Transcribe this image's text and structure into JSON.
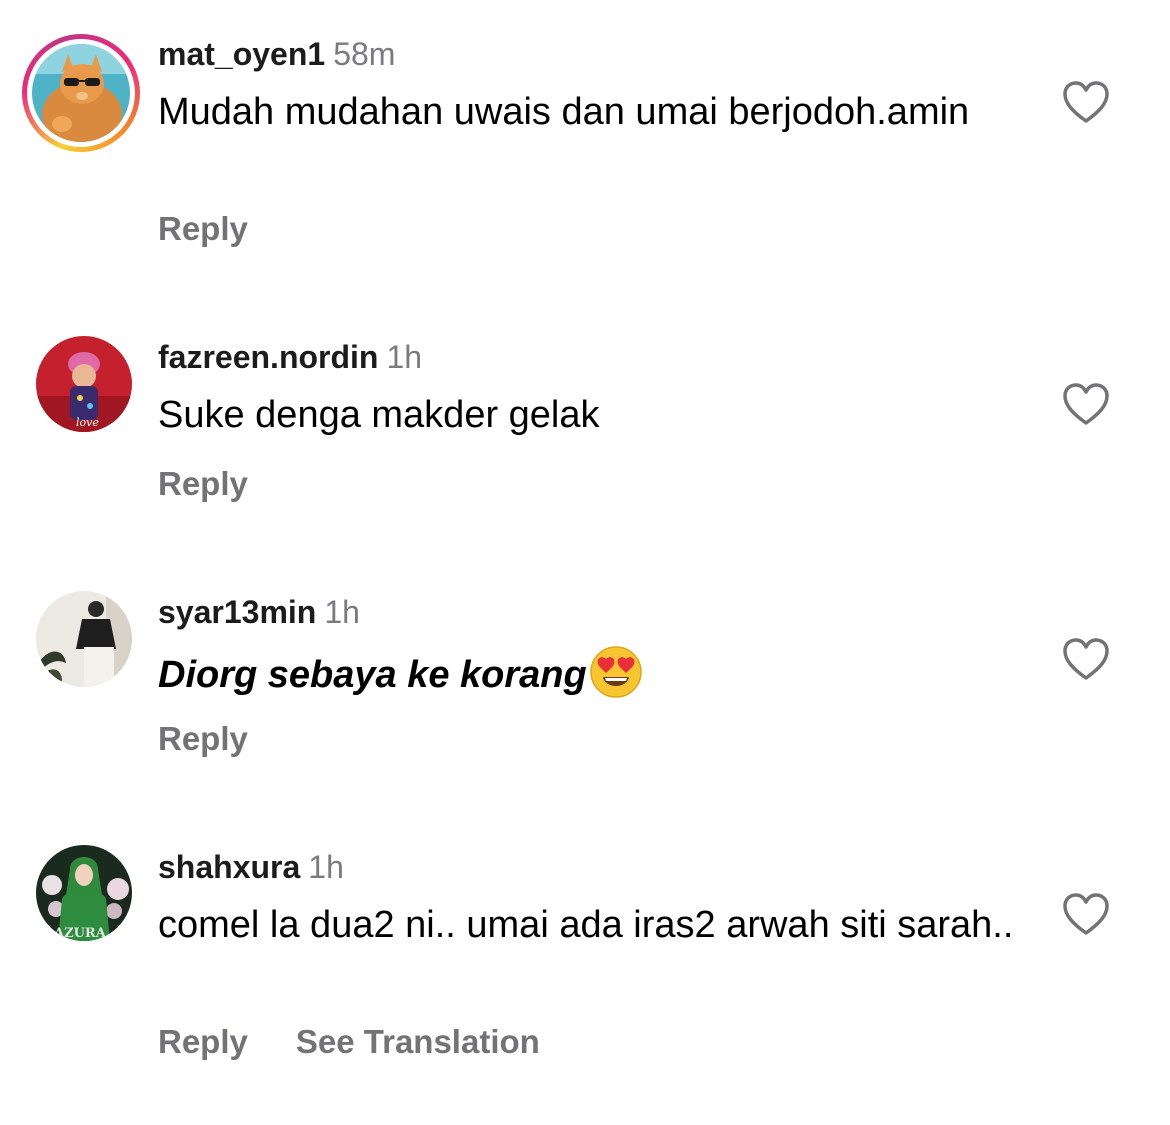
{
  "comments": [
    {
      "username": "mat_oyen1",
      "time": "58m",
      "text": "Mudah mudahan uwais dan umai berjodoh.amin",
      "reply_label": "Reply",
      "has_story_ring": true,
      "liked": false
    },
    {
      "username": "fazreen.nordin",
      "time": "1h",
      "text": "Suke denga makder gelak",
      "reply_label": "Reply",
      "has_story_ring": false,
      "liked": false
    },
    {
      "username": "syar13min",
      "time": "1h",
      "text": "Diorg sebaya ke korang",
      "emoji": "smiling-face-with-heart-eyes",
      "reply_label": "Reply",
      "has_story_ring": false,
      "liked": false
    },
    {
      "username": "shahxura",
      "time": "1h",
      "text": "comel la dua2 ni.. umai ada iras2 arwah siti sarah..",
      "reply_label": "Reply",
      "translation_label": "See Translation",
      "has_story_ring": false,
      "liked": false
    }
  ],
  "colors": {
    "username": "#1c1c1c",
    "secondary_text": "#737377",
    "heart_outline": "#737377",
    "story_ring": [
      "#f9ce34",
      "#ee2a7b",
      "#c13584"
    ]
  },
  "icons": {
    "like": "heart-outline-icon"
  }
}
